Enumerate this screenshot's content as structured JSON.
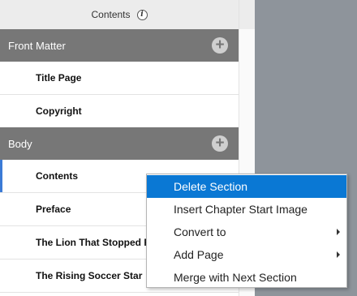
{
  "panel": {
    "title": "Contents",
    "info_icon": "i"
  },
  "sections": [
    {
      "name": "Front Matter",
      "add_icon": "+",
      "pages": [
        "Title Page",
        "Copyright"
      ]
    },
    {
      "name": "Body",
      "add_icon": "+",
      "pages": [
        "Contents",
        "Preface",
        "The Lion That Stopped Roaring",
        "The Rising Soccer Star"
      ]
    }
  ],
  "context_menu": {
    "items": [
      {
        "label": "Delete Section",
        "highlighted": true
      },
      {
        "label": "Insert Chapter Start Image"
      },
      {
        "label": "Convert to",
        "submenu": true
      },
      {
        "label": "Add Page",
        "submenu": true
      },
      {
        "label": "Merge with Next Section"
      }
    ]
  },
  "colors": {
    "background": "#8e949b",
    "section_header": "#777777",
    "menu_highlight": "#0a78d4",
    "selected_marker": "#3b7bd6"
  }
}
